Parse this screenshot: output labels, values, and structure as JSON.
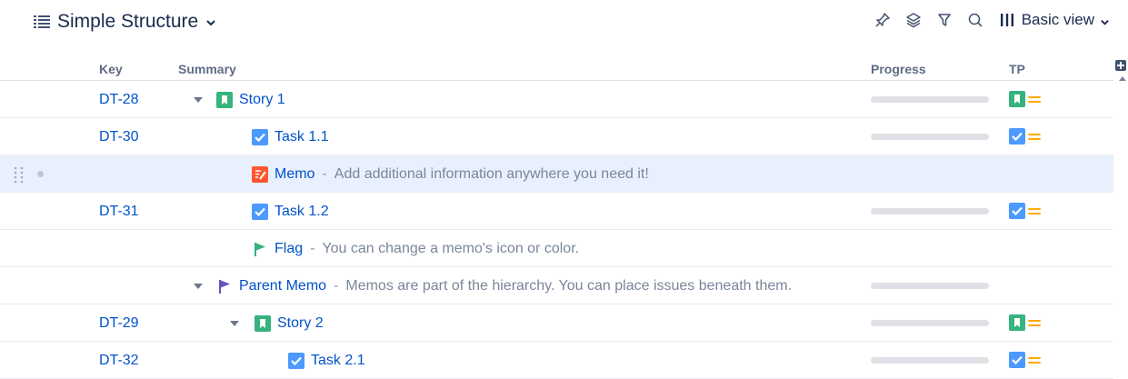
{
  "structure": {
    "title": "Simple Structure"
  },
  "toolbar": {
    "view_label": "Basic view"
  },
  "columns": {
    "key": "Key",
    "summary": "Summary",
    "progress": "Progress",
    "tp": "TP"
  },
  "rows": [
    {
      "key": "DT-28",
      "type": "story",
      "title": "Story 1",
      "desc": ""
    },
    {
      "key": "DT-30",
      "type": "task",
      "title": "Task 1.1",
      "desc": ""
    },
    {
      "key": "",
      "type": "memo",
      "title": "Memo",
      "sep": "-",
      "desc": "Add additional information anywhere you need it!"
    },
    {
      "key": "DT-31",
      "type": "task",
      "title": "Task 1.2",
      "desc": ""
    },
    {
      "key": "",
      "type": "flag",
      "title": "Flag",
      "sep": "-",
      "desc": "You can change a memo's icon or color."
    },
    {
      "key": "",
      "type": "parent-memo",
      "title": "Parent Memo",
      "sep": "-",
      "desc": "Memos are part of the hierarchy. You can place issues beneath them."
    },
    {
      "key": "DT-29",
      "type": "story",
      "title": "Story 2",
      "desc": ""
    },
    {
      "key": "DT-32",
      "type": "task",
      "title": "Task 2.1",
      "desc": ""
    }
  ],
  "colors": {
    "link": "#0052cc",
    "story": "#36b37e",
    "task": "#4c9aff",
    "memo": "#ff5630",
    "flag": "#36b37e",
    "parent_memo": "#6554c0",
    "priority": "#ffab00",
    "selected_row": "#e9f0fd"
  }
}
